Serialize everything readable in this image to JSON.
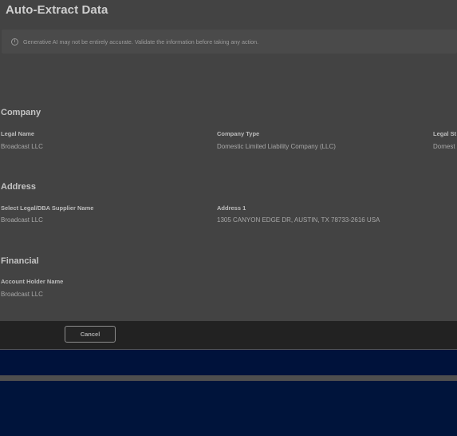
{
  "modal": {
    "title": "Auto-Extract Data",
    "disclaimer": "Generative AI may not be entirely accurate. Validate the information before taking any action.",
    "sections": {
      "company": {
        "heading": "Company",
        "legal_name_label": "Legal Name",
        "legal_name_value": "Broadcast LLC",
        "company_type_label": "Company Type",
        "company_type_value": "Domestic Limited Liability Company (LLC)",
        "legal_structure_label": "Legal St",
        "legal_structure_value": "Domest"
      },
      "address": {
        "heading": "Address",
        "supplier_name_label": "Select Legal/DBA Supplier Name",
        "supplier_name_value": "Broadcast LLC",
        "address1_label": "Address 1",
        "address1_value": "1305 CANYON EDGE DR, AUSTIN, TX 78733-2616 USA"
      },
      "financial": {
        "heading": "Financial",
        "account_holder_label": "Account Holder Name",
        "account_holder_value": "Broadcast LLC"
      }
    },
    "footer": {
      "cancel_label": "Cancel"
    }
  },
  "icons": {
    "disclaimer": "info-icon"
  },
  "colors": {
    "overlay_background": "#424242",
    "footer_bar": "#222222",
    "underlying_navy": "#00123b"
  }
}
